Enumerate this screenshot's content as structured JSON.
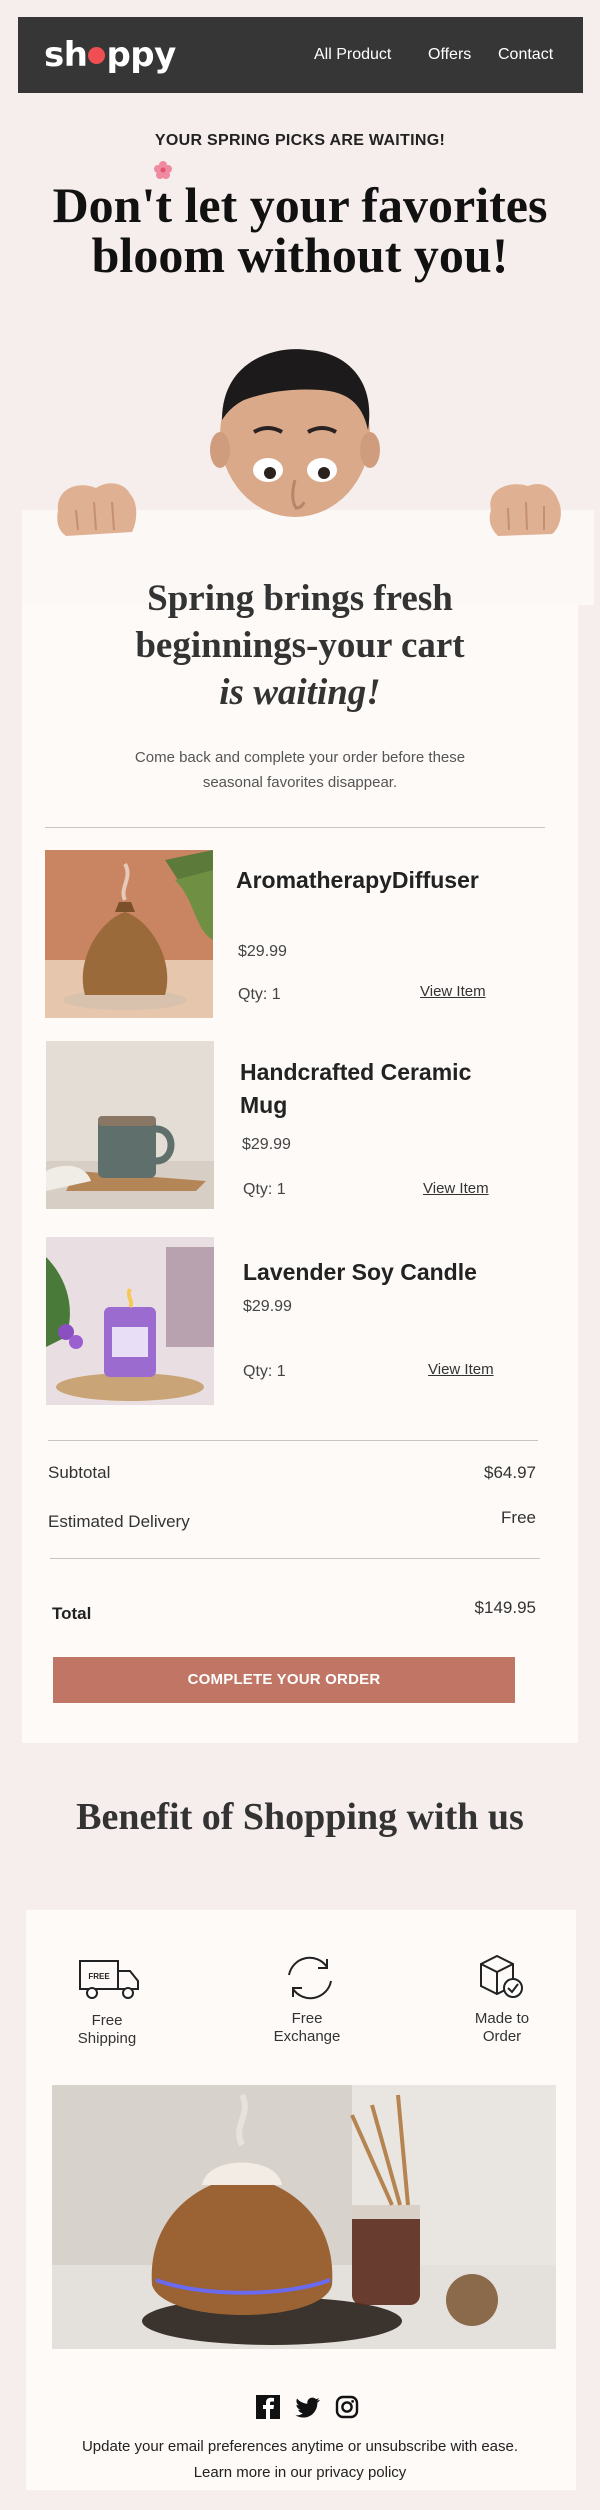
{
  "header": {
    "logo_before": "sh",
    "logo_after": "ppy",
    "nav": [
      "All Product",
      "Offers",
      "Contact"
    ]
  },
  "hero": {
    "eyebrow": "YOUR SPRING PICKS ARE WAITING!",
    "title_line1": "Don't let your favorites",
    "title_line2": "bloom without you!"
  },
  "cart": {
    "title_line1": "Spring brings fresh",
    "title_line2": "beginnings-your cart",
    "title_line3": "is waiting!",
    "subtitle": "Come back and complete your order before these seasonal favorites disappear.",
    "items": [
      {
        "name": "AromatherapyDiffuser",
        "price": "$29.99",
        "qty": "Qty: 1",
        "link": "View Item"
      },
      {
        "name": "Handcrafted Ceramic Mug",
        "price": "$29.99",
        "qty": "Qty: 1",
        "link": "View Item"
      },
      {
        "name": "Lavender Soy Candle",
        "price": "$29.99",
        "qty": "Qty: 1",
        "link": "View Item"
      }
    ],
    "subtotal_label": "Subtotal",
    "subtotal_value": "$64.97",
    "delivery_label": "Estimated Delivery",
    "delivery_value": "Free",
    "total_label": "Total",
    "total_value": "$149.95",
    "cta": "COMPLETE YOUR ORDER"
  },
  "benefits": {
    "title": "Benefit of Shopping with us",
    "items": [
      {
        "label_line1": "Free",
        "label_line2": "Shipping",
        "icon": "truck-icon",
        "badge": "FREE"
      },
      {
        "label_line1": "Free",
        "label_line2": "Exchange",
        "icon": "exchange-icon"
      },
      {
        "label_line1": "Made to",
        "label_line2": "Order",
        "icon": "box-check-icon"
      }
    ]
  },
  "footer": {
    "social": [
      "facebook-icon",
      "twitter-icon",
      "instagram-icon"
    ],
    "line1": "Update your email preferences anytime or unsubscribe with ease.",
    "line2": "Learn more in our privacy policy"
  },
  "colors": {
    "background": "#f6eeec",
    "header": "#363636",
    "accent": "#c07565",
    "logo_dot": "#ef4f53"
  }
}
